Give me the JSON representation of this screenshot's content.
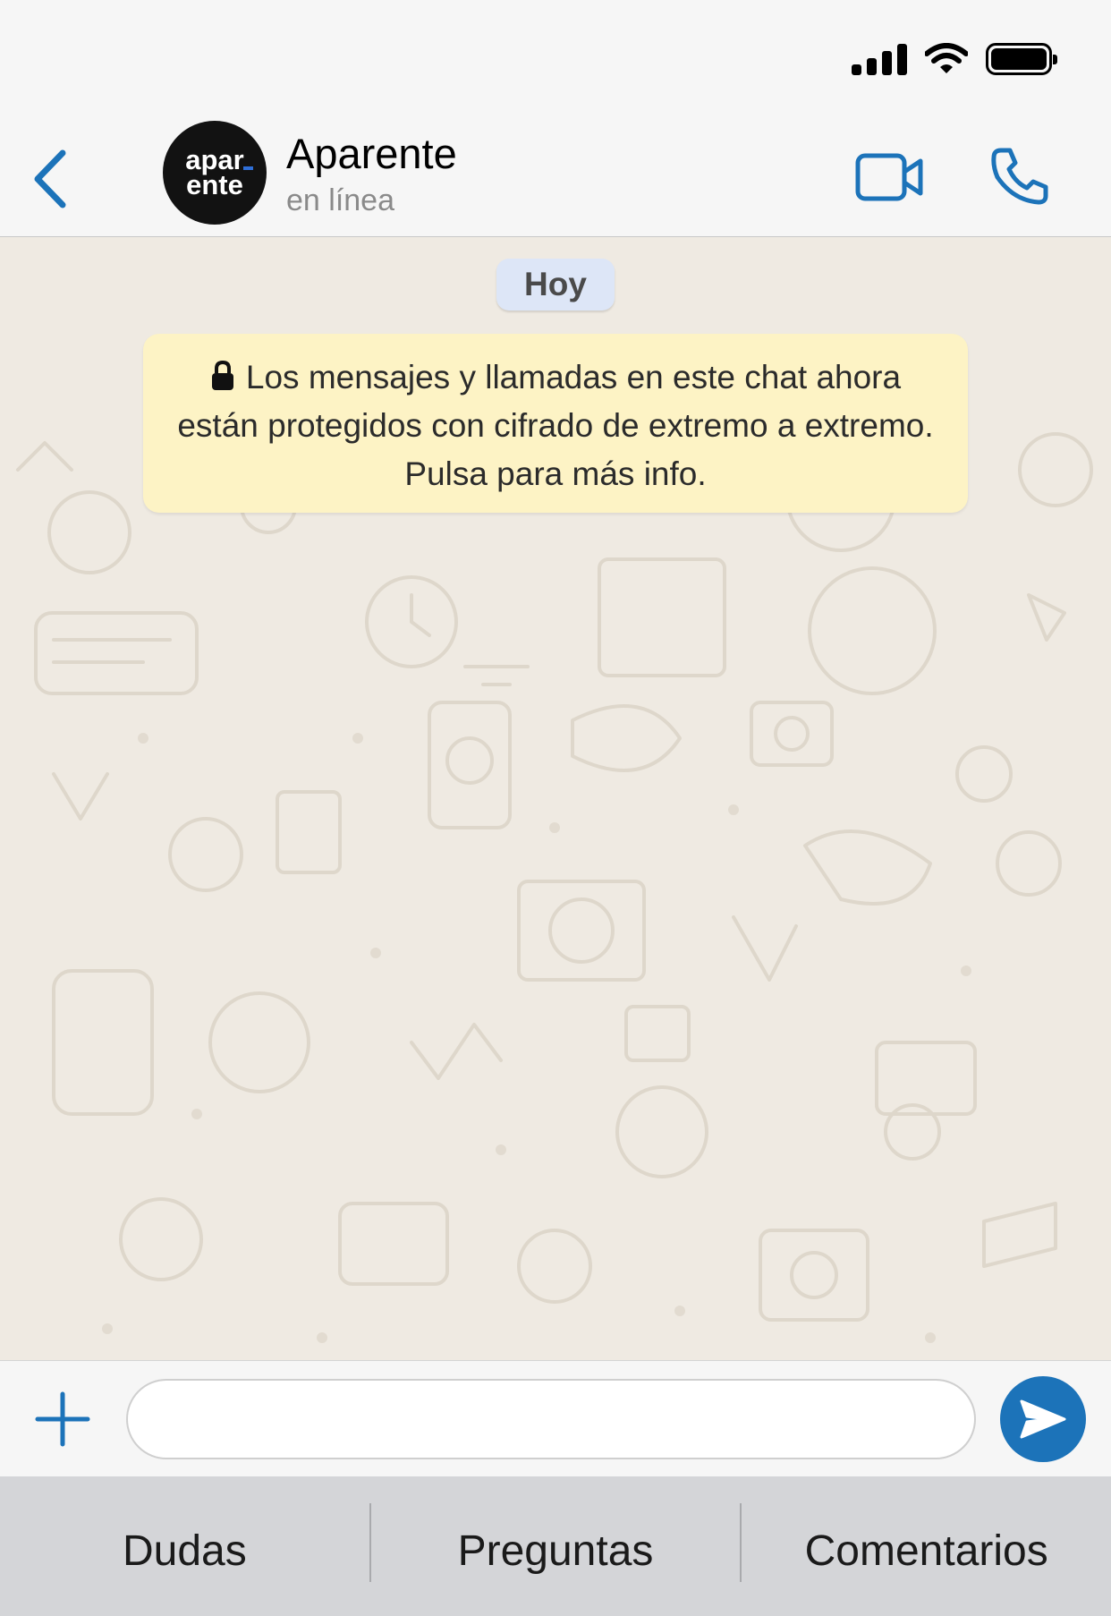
{
  "header": {
    "contact_name": "Aparente",
    "contact_status": "en línea",
    "avatar_line1": "apar",
    "avatar_line2": "ente",
    "accent_color": "#1c73b9"
  },
  "chat": {
    "date_chip": "Hoy",
    "encryption_notice": "Los mensajes y llamadas en este chat ahora están protegidos con cifrado de extremo a extremo. Pulsa para más info.",
    "background_color": "#efeae2",
    "notice_color": "#fdf3c5"
  },
  "input": {
    "value": "",
    "placeholder": ""
  },
  "quick_replies": [
    "Dudas",
    "Preguntas",
    "Comentarios"
  ],
  "icons": {
    "back": "chevron-left-icon",
    "video": "video-camera-icon",
    "call": "phone-icon",
    "lock": "lock-icon",
    "plus": "plus-icon",
    "send": "send-icon"
  }
}
